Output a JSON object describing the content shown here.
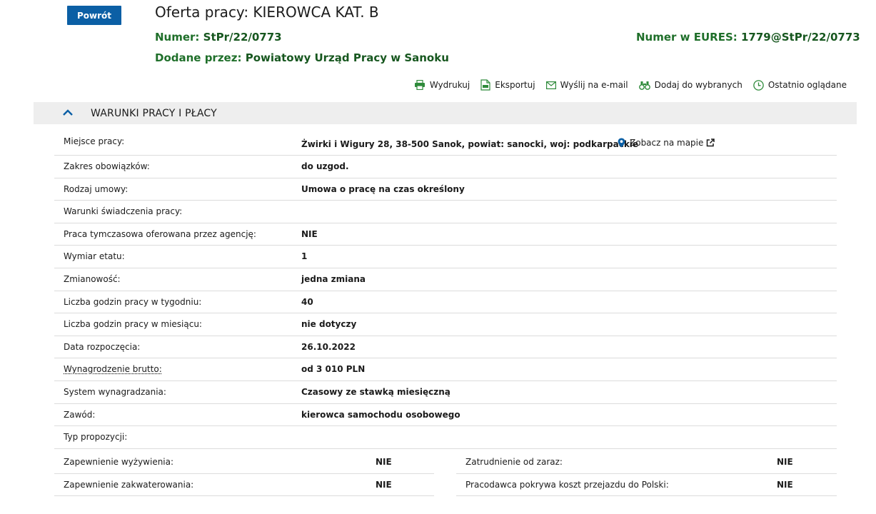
{
  "header": {
    "back_label": "Powrót",
    "title": "Oferta pracy: KIEROWCA KAT. B",
    "number_key": "Numer:",
    "number_value": "StPr/22/0773",
    "eures_key": "Numer w EURES:",
    "eures_value": "1779@StPr/22/0773",
    "added_key": "Dodane przez:",
    "added_value": "Powiatowy Urząd Pracy w Sanoku"
  },
  "toolbar": {
    "print": "Wydrukuj",
    "export": "Eksportuj",
    "email": "Wyślij na e-mail",
    "favorite": "Dodaj do wybranych",
    "recent": "Ostatnio oglądane"
  },
  "section": {
    "title": "WARUNKI PRACY I PŁACY"
  },
  "details": {
    "rows": [
      {
        "label": "Miejsce pracy:",
        "value": "Żwirki i Wigury 28, 38-500 Sanok, powiat: sanocki, woj: podkarpackie"
      },
      {
        "label": "Zakres obowiązków:",
        "value": "do uzgod."
      },
      {
        "label": "Rodzaj umowy:",
        "value": "Umowa o pracę na czas określony"
      },
      {
        "label": "Warunki świadczenia pracy:",
        "value": ""
      },
      {
        "label": "Praca tymczasowa oferowana przez agencję:",
        "value": "NIE"
      },
      {
        "label": "Wymiar etatu:",
        "value": "1"
      },
      {
        "label": "Zmianowość:",
        "value": "jedna zmiana"
      },
      {
        "label": "Liczba godzin pracy w tygodniu:",
        "value": "40"
      },
      {
        "label": "Liczba godzin pracy w miesiącu:",
        "value": "nie dotyczy"
      },
      {
        "label": "Data rozpoczęcia:",
        "value": "26.10.2022"
      },
      {
        "label": "Wynagrodzenie brutto:",
        "value": "od 3 010 PLN"
      },
      {
        "label": "System wynagradzania:",
        "value": "Czasowy ze stawką miesięczną"
      },
      {
        "label": "Zawód:",
        "value": "kierowca samochodu osobowego"
      },
      {
        "label": "Typ propozycji:",
        "value": ""
      }
    ],
    "map_link": "Zobacz na mapie"
  },
  "extras": {
    "left": [
      {
        "label": "Zapewnienie wyżywienia:",
        "value": "NIE"
      },
      {
        "label": "Zapewnienie zakwaterowania:",
        "value": "NIE"
      }
    ],
    "right": [
      {
        "label": "Zatrudnienie od zaraz:",
        "value": "NIE"
      },
      {
        "label": "Pracodawca pokrywa koszt przejazdu do Polski:",
        "value": "NIE"
      }
    ]
  },
  "colors": {
    "primary_button": "#0b5fa5",
    "meta_green": "#1f6f2a",
    "icon_green": "#2e8a3a",
    "map_pin_blue": "#0b5fa5",
    "section_bg": "#eeeeee"
  }
}
